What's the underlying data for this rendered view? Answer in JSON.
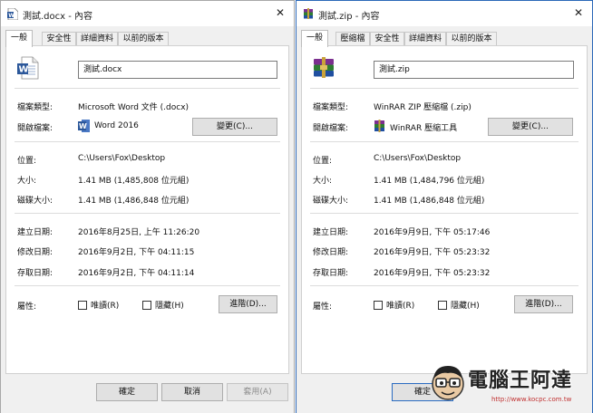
{
  "left_dialog": {
    "title": "測試.docx - 內容",
    "tabs": [
      {
        "label": "一般",
        "active": true
      },
      {
        "label": "安全性",
        "active": false
      },
      {
        "label": "詳細資料",
        "active": false
      },
      {
        "label": "以前的版本",
        "active": false
      }
    ],
    "file_name": "測試.docx",
    "file_icon": "word-document-icon",
    "labels": {
      "file_type": "檔案類型:",
      "opens_with": "開啟檔案:",
      "location": "位置:",
      "size": "大小:",
      "size_on_disk": "磁碟大小:",
      "created": "建立日期:",
      "modified": "修改日期:",
      "accessed": "存取日期:",
      "attributes": "屬性:"
    },
    "file_type": "Microsoft Word 文件 (.docx)",
    "opens_with": "Word 2016",
    "opens_with_icon": "word-icon",
    "change_button": "變更(C)...",
    "location": "C:\\Users\\Fox\\Desktop",
    "size": "1.41 MB (1,485,808 位元組)",
    "size_on_disk": "1.41 MB (1,486,848 位元組)",
    "created": "2016年8月25日, 上午 11:26:20",
    "modified": "2016年9月2日, 下午 04:11:15",
    "accessed": "2016年9月2日, 下午 04:11:14",
    "readonly_label": "唯讀(R)",
    "readonly_checked": false,
    "hidden_label": "隱藏(H)",
    "hidden_checked": false,
    "advanced_button": "進階(D)...",
    "ok_button": "確定",
    "cancel_button": "取消",
    "apply_button": "套用(A)"
  },
  "right_dialog": {
    "title": "測試.zip - 內容",
    "tabs": [
      {
        "label": "一般",
        "active": true
      },
      {
        "label": "壓縮檔",
        "active": false
      },
      {
        "label": "安全性",
        "active": false
      },
      {
        "label": "詳細資料",
        "active": false
      },
      {
        "label": "以前的版本",
        "active": false
      }
    ],
    "file_name": "測試.zip",
    "file_icon": "winrar-archive-icon",
    "labels": {
      "file_type": "檔案類型:",
      "opens_with": "開啟檔案:",
      "location": "位置:",
      "size": "大小:",
      "size_on_disk": "磁碟大小:",
      "created": "建立日期:",
      "modified": "修改日期:",
      "accessed": "存取日期:",
      "attributes": "屬性:"
    },
    "file_type": "WinRAR ZIP 壓縮檔 (.zip)",
    "opens_with": "WinRAR 壓縮工具",
    "opens_with_icon": "winrar-icon",
    "change_button": "變更(C)...",
    "location": "C:\\Users\\Fox\\Desktop",
    "size": "1.41 MB (1,484,796 位元組)",
    "size_on_disk": "1.41 MB (1,486,848 位元組)",
    "created": "2016年9月9日, 下午 05:17:46",
    "modified": "2016年9月9日, 下午 05:23:32",
    "accessed": "2016年9月9日, 下午 05:23:32",
    "readonly_label": "唯讀(R)",
    "readonly_checked": false,
    "hidden_label": "隱藏(H)",
    "hidden_checked": false,
    "advanced_button": "進階(D)...",
    "ok_button": "確定"
  },
  "watermark": {
    "text": "電腦王阿達",
    "url": "http://www.kocpc.com.tw"
  },
  "colors": {
    "word_blue": "#2b579a",
    "focus_border": "#2a6bc1",
    "watermark_url": "#c03030"
  }
}
